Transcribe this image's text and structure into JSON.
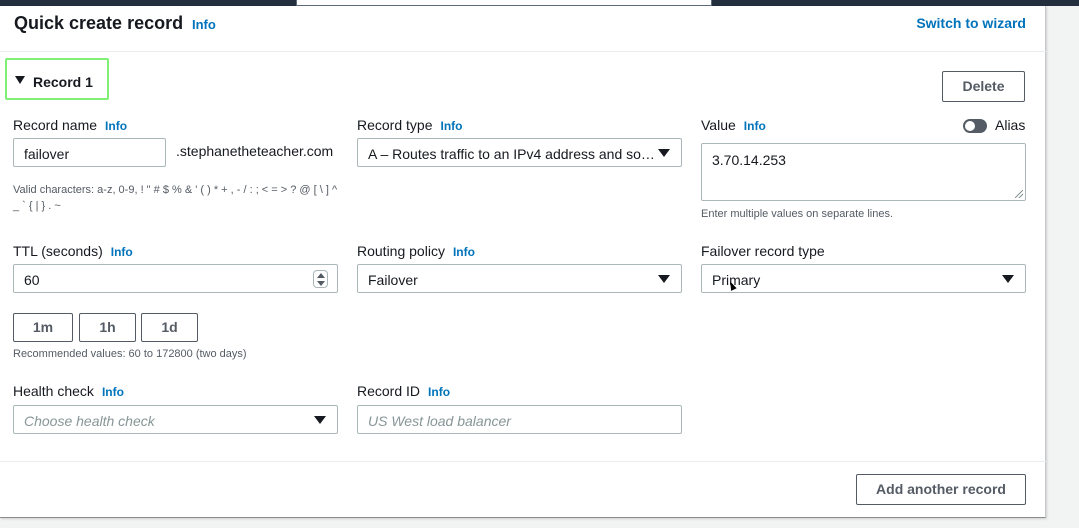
{
  "header": {
    "title": "Quick create record",
    "info": "Info",
    "switch_link": "Switch to wizard"
  },
  "record": {
    "expander_label": "Record 1",
    "delete_label": "Delete",
    "record_name": {
      "label": "Record name",
      "info": "Info",
      "value": "failover",
      "suffix": ".stephanetheteacher.com",
      "hint": "Valid characters: a-z, 0-9, ! \" # $ % & ' ( ) * + , - / : ; < = > ? @ [ \\ ] ^ _ ` { | } . ~"
    },
    "record_type": {
      "label": "Record type",
      "info": "Info",
      "value": "A – Routes traffic to an IPv4 address and so…"
    },
    "value": {
      "label": "Value",
      "info": "Info",
      "value": "3.70.14.253",
      "hint": "Enter multiple values on separate lines.",
      "alias_label": "Alias",
      "alias_enabled": false
    },
    "ttl": {
      "label": "TTL (seconds)",
      "info": "Info",
      "value": "60",
      "quick_buttons": [
        "1m",
        "1h",
        "1d"
      ],
      "hint": "Recommended values: 60 to 172800 (two days)"
    },
    "routing_policy": {
      "label": "Routing policy",
      "info": "Info",
      "value": "Failover"
    },
    "failover_type": {
      "label": "Failover record type",
      "value": "Primary"
    },
    "health_check": {
      "label": "Health check",
      "info": "Info",
      "placeholder": "Choose health check"
    },
    "record_id": {
      "label": "Record ID",
      "info": "Info",
      "placeholder": "US West load balancer"
    }
  },
  "footer": {
    "add_label": "Add another record"
  },
  "colors": {
    "link": "#0073bb",
    "focus_outline": "#7ff074",
    "topbar": "#232f3e"
  }
}
